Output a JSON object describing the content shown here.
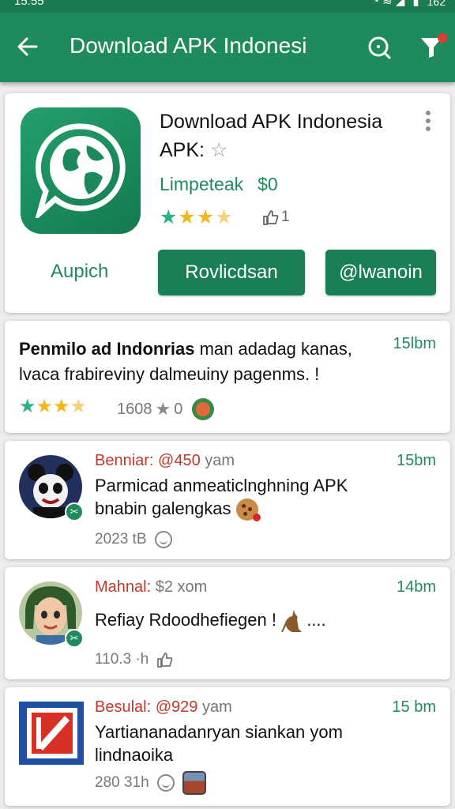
{
  "status_bar": {
    "time": "15:55",
    "battery": "162"
  },
  "appbar": {
    "title": "Download APK Indonesi"
  },
  "app_card": {
    "name_line1": "Download APK Indonesia",
    "name_line2": "APK:",
    "developer": "Limpeteak",
    "price": "$0",
    "rating_stars": 4,
    "likes": "1",
    "text_action": "Aupich",
    "primary_button": "Rovlicdsan",
    "secondary_button": "@lwanoin"
  },
  "feature_post": {
    "headline_bold": "Penmilo ad Indonrias",
    "headline_rest": " man adadag kanas, lvaca frabireviny dalmeuiny pagenms. !",
    "time": "15lbm",
    "rating_stars": 4,
    "count": "1608",
    "count_suffix": "0"
  },
  "posts": [
    {
      "user": "Benniar: @450",
      "user_suffix": " yam",
      "time": "15bm",
      "body": "Parmicad anmeaticlnghning APK bnabin galengkas",
      "meta": "2023 tB"
    },
    {
      "user": "Mahnal:",
      "user_suffix": " $2 xom",
      "time": "14bm",
      "body": "Refiay Rdoodhefiegen !",
      "body_suffix": "....",
      "meta": "110.3 ·h"
    },
    {
      "user": "Besulal: @929",
      "user_suffix": " yam",
      "time": "15 bm",
      "body": "Yartiananadanryan siankan yom lindnaoika",
      "meta": "280 31h"
    }
  ],
  "colors": {
    "brand_green": "#1f8a5b",
    "username_red": "#c0392b"
  }
}
